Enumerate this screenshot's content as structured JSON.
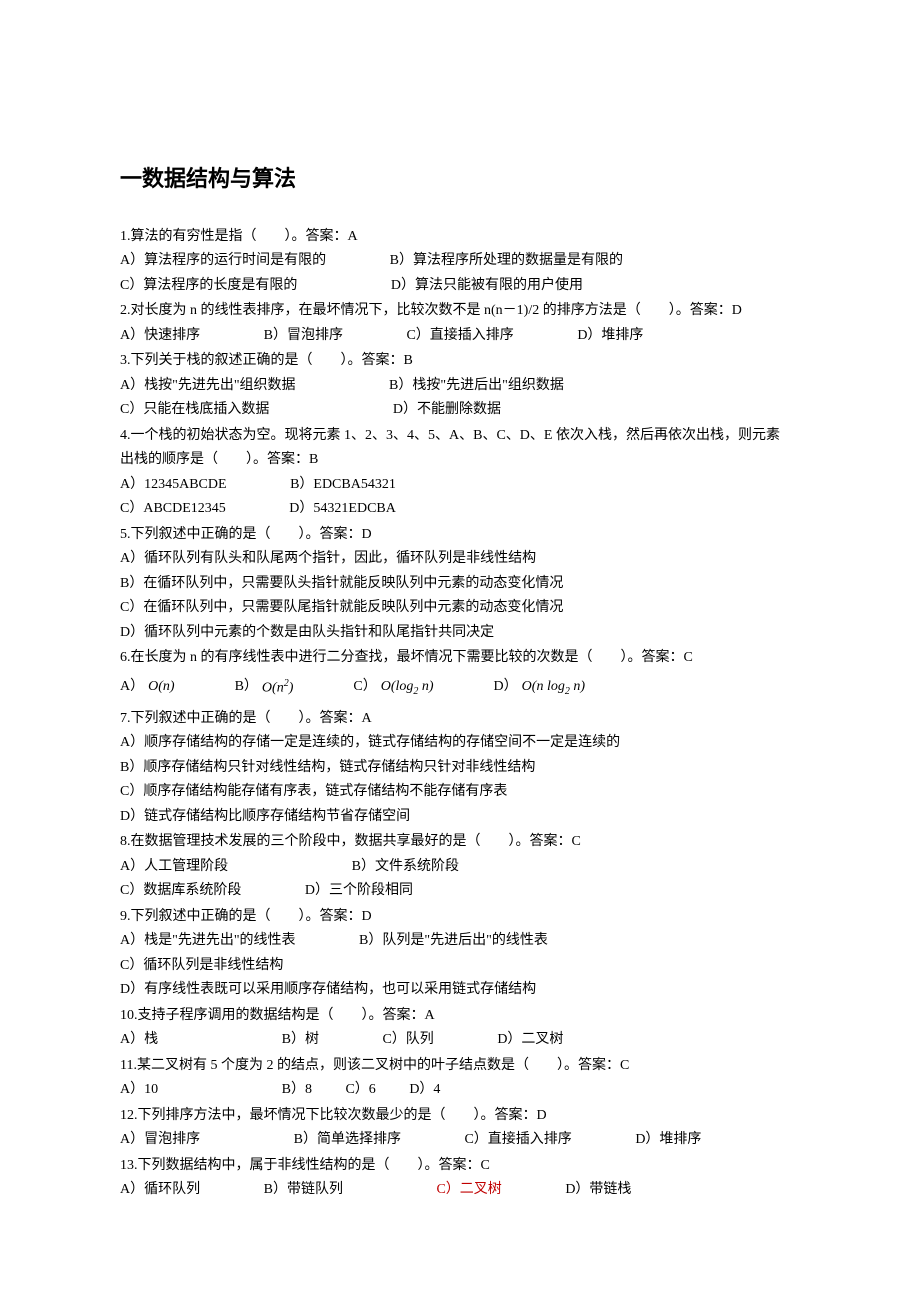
{
  "title": "一数据结构与算法",
  "q1": {
    "stem": "1.算法的有穷性是指（　　）。答案：A",
    "a": "A）算法程序的运行时间是有限的",
    "b": "B）算法程序所处理的数据量是有限的",
    "c": "C）算法程序的长度是有限的",
    "d": "D）算法只能被有限的用户使用"
  },
  "q2": {
    "stem": "2.对长度为 n 的线性表排序，在最坏情况下，比较次数不是 n(n－1)/2 的排序方法是（　　）。答案：D",
    "a": "A）快速排序",
    "b": "B）冒泡排序",
    "c": "C）直接插入排序",
    "d": "D）堆排序"
  },
  "q3": {
    "stem": "3.下列关于栈的叙述正确的是（　　）。答案：B",
    "a": "A）栈按\"先进先出\"组织数据",
    "b": "B）栈按\"先进后出\"组织数据",
    "c": "C）只能在栈底插入数据",
    "d": "D）不能删除数据"
  },
  "q4": {
    "stem1": "4.一个栈的初始状态为空。现将元素 1、2、3、4、5、A、B、C、D、E 依次入栈，然后再依次出栈，则元素",
    "stem2": "出栈的顺序是（　　）。答案：B",
    "a": "A）12345ABCDE",
    "b": "B）EDCBA54321",
    "c": "C）ABCDE12345",
    "d": "D）54321EDCBA"
  },
  "q5": {
    "stem": "5.下列叙述中正确的是（　　）。答案：D",
    "a": "A）循环队列有队头和队尾两个指针，因此，循环队列是非线性结构",
    "b": "B）在循环队列中，只需要队头指针就能反映队列中元素的动态变化情况",
    "c": "C）在循环队列中，只需要队尾指针就能反映队列中元素的动态变化情况",
    "d": "D）循环队列中元素的个数是由队头指针和队尾指针共同决定"
  },
  "q6": {
    "stem": "6.在长度为 n 的有序线性表中进行二分查找，最坏情况下需要比较的次数是（　　）。答案：C",
    "a_label": "A）",
    "a_formula": "O(n)",
    "b_label": "B）",
    "b_formula_pre": "O(",
    "b_formula_n": "n",
    "b_formula_sup": "2",
    "b_formula_post": ")",
    "c_label": "C）",
    "c_formula_pre": "O(log",
    "c_formula_sub": "2",
    "c_formula_n": " n",
    "c_formula_post": ")",
    "d_label": "D）",
    "d_formula_pre": "O(",
    "d_formula_n": "n ",
    "d_formula_log": "log",
    "d_formula_sub": "2",
    "d_formula_n2": " n",
    "d_formula_post": ")"
  },
  "q7": {
    "stem": "7.下列叙述中正确的是（　　）。答案：A",
    "a": "A）顺序存储结构的存储一定是连续的，链式存储结构的存储空间不一定是连续的",
    "b": "B）顺序存储结构只针对线性结构，链式存储结构只针对非线性结构",
    "c": "C）顺序存储结构能存储有序表，链式存储结构不能存储有序表",
    "d": "D）链式存储结构比顺序存储结构节省存储空间"
  },
  "q8": {
    "stem": "8.在数据管理技术发展的三个阶段中，数据共享最好的是（　　）。答案：C",
    "a": "A）人工管理阶段",
    "b": "B）文件系统阶段",
    "c": "C）数据库系统阶段",
    "d": "D）三个阶段相同"
  },
  "q9": {
    "stem": "9.下列叙述中正确的是（　　）。答案：D",
    "a": "A）栈是\"先进先出\"的线性表",
    "b": "B）队列是\"先进后出\"的线性表",
    "c": "C）循环队列是非线性结构",
    "d": "D）有序线性表既可以采用顺序存储结构，也可以采用链式存储结构"
  },
  "q10": {
    "stem": "10.支持子程序调用的数据结构是（　　）。答案：A",
    "a": "A）栈",
    "b": "B）树",
    "c": "C）队列",
    "d": "D）二叉树"
  },
  "q11": {
    "stem": "11.某二叉树有 5 个度为 2 的结点，则该二叉树中的叶子结点数是（　　）。答案：C",
    "a": "A）10",
    "b": "B）8",
    "c": "C）6",
    "d": "D）4"
  },
  "q12": {
    "stem": "12.下列排序方法中，最坏情况下比较次数最少的是（　　）。答案：D",
    "a": "A）冒泡排序",
    "b": "B）简单选择排序",
    "c": "C）直接插入排序",
    "d": "D）堆排序"
  },
  "q13": {
    "stem": "13.下列数据结构中，属于非线性结构的是（　　）。答案：C",
    "a": "A）循环队列",
    "b": "B）带链队列",
    "c": "C）二叉树",
    "d": "D）带链栈"
  }
}
